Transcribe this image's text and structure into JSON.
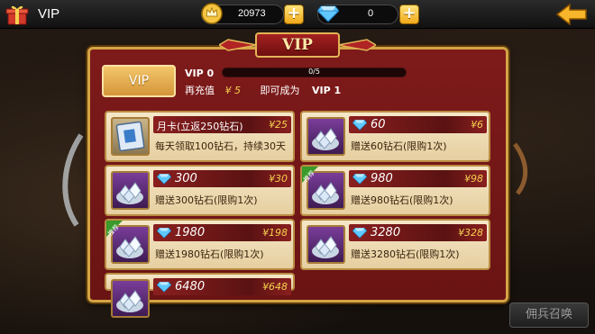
{
  "topbar": {
    "title": "VIP",
    "gold": {
      "value": "20973",
      "icon": "crown-coin-icon"
    },
    "diamond": {
      "value": "0",
      "icon": "diamond-icon"
    },
    "plus_label": "+"
  },
  "panel": {
    "title": "VIP",
    "vip_badge": "VIP",
    "current_level": "VIP 0",
    "progress": {
      "text": "0/5",
      "fraction": 0.0
    },
    "recharge_label": "再充值",
    "recharge_amount": "¥ 5",
    "become_label": "即可成为",
    "target_vip": "VIP  1"
  },
  "items": [
    {
      "title": "月卡(立返250钻石)",
      "price": "¥25",
      "desc": "每天领取100钻石，持续30天",
      "thumb": "card",
      "recommended": false,
      "gem": false
    },
    {
      "title": "60",
      "price": "¥6",
      "desc": "赠送60钻石(限购1次)",
      "thumb": "diamonds",
      "recommended": false,
      "gem": true
    },
    {
      "title": "300",
      "price": "¥30",
      "desc": "赠送300钻石(限购1次)",
      "thumb": "diamonds",
      "recommended": false,
      "gem": true
    },
    {
      "title": "980",
      "price": "¥98",
      "desc": "赠送980钻石(限购1次)",
      "thumb": "diamonds",
      "recommended": true,
      "gem": true
    },
    {
      "title": "1980",
      "price": "¥198",
      "desc": "赠送1980钻石(限购1次)",
      "thumb": "bag",
      "recommended": true,
      "gem": true
    },
    {
      "title": "3280",
      "price": "¥328",
      "desc": "赠送3280钻石(限购1次)",
      "thumb": "chest",
      "recommended": false,
      "gem": true
    },
    {
      "title": "6480",
      "price": "¥648",
      "desc": "",
      "thumb": "chest",
      "recommended": false,
      "gem": true
    }
  ],
  "recommend_tag": "推荐",
  "bottom_button": "佣兵召唤",
  "colors": {
    "panel_red": "#7e1a1a",
    "gold_border": "#d4a445",
    "price_gold": "#f5d14f"
  }
}
